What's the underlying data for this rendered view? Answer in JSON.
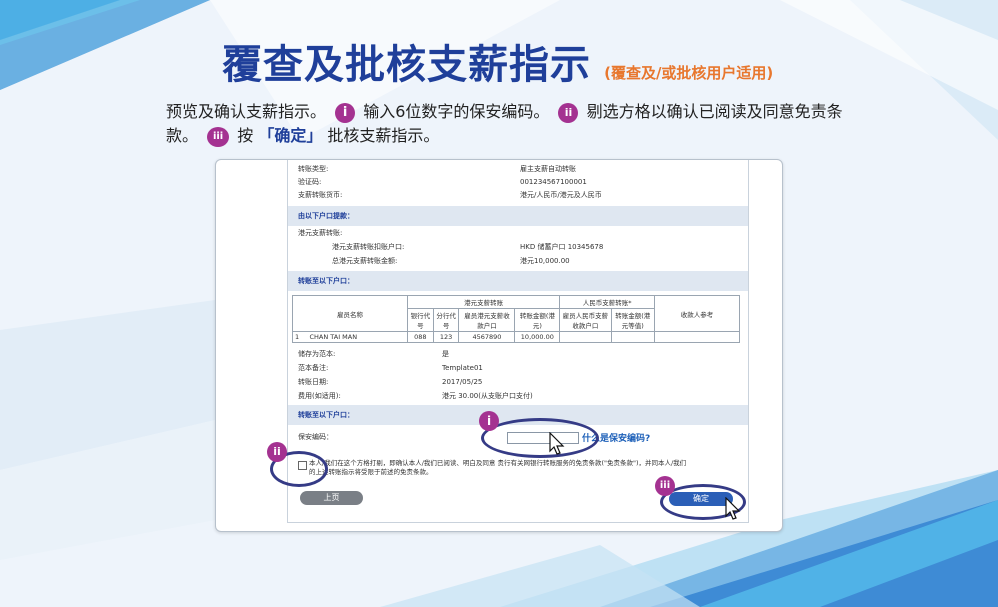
{
  "title": {
    "main": "覆查及批核支薪指示",
    "sub": "(覆查及/或批核用户适用)"
  },
  "instructions": {
    "part1": "预览及确认支薪指示。",
    "badge1": "i",
    "part2": "输入6位数字的保安编码。",
    "badge2": "ii",
    "part3": "剔选方格以确认已阅读及同意免责条款。",
    "badge3": "iii",
    "part4": "按",
    "confirm_label": "「确定」",
    "part5": "批核支薪指示。"
  },
  "colors": {
    "title": "#1f3f9a",
    "subtitle": "#e8772e",
    "badge": "#a43291",
    "ring": "#353b86",
    "section_bg": "#dfe7f1",
    "confirm_button": "#2b5fb7"
  },
  "form": {
    "summary": [
      {
        "label": "转账类型:",
        "value": "雇主支薪自动转账"
      },
      {
        "label": "验证码:",
        "value": "001234567100001"
      },
      {
        "label": "支薪转账货币:",
        "value": "港元/人民币/港元及人民币"
      }
    ],
    "section_from": "由以下户口提款：",
    "hkd_payroll": "港元支薪转账:",
    "debit_account_label": "港元支薪转账扣账户口:",
    "debit_account_value": "HKD 储蓄户口 10345678",
    "total_label": "总港元支薪转账金额:",
    "total_value": "港元10,000.00",
    "section_to": "转账至以下户口：",
    "table": {
      "group_hkd": "港元支薪转账",
      "group_rmb": "人民币支薪转账*",
      "col_name": "雇员名称",
      "col_bank": "银行代号",
      "col_branch": "分行代号",
      "col_acct": "雇员港元支薪收款户口",
      "col_amount": "转账金额(港元)",
      "col_rmb_acct": "雇员人民币支薪收款户口",
      "col_rmb_amount": "转账金额(港元等值)",
      "col_ref": "收款人参考",
      "row": {
        "no": "1",
        "name": "CHAN TAI MAN",
        "bank": "088",
        "branch": "123",
        "acct": "4567890",
        "amount": "10,000.00"
      }
    },
    "details": [
      {
        "label": "储存为范本:",
        "value": "是"
      },
      {
        "label": "范本备注:",
        "value": "Template01"
      },
      {
        "label": "转账日期:",
        "value": "2017/05/25"
      },
      {
        "label": "费用(如适用):",
        "value": "港元 30.00(从支账户口支付)"
      }
    ],
    "section_to2": "转账至以下户口：",
    "security_label": "保安编码：",
    "security_value": "",
    "help_link": "什么是保安编码?",
    "terms_line1": "本人/我们在这个方格打剔，即确认本人/我们已阅读、明白及同意 贵行有关网银行转账服务的免责条款(\"免责条款\")，并同本人/我们",
    "terms_line2": "的上述转账指示将受限于前述的免责条款。",
    "back_button": "上页",
    "confirm_button": "确定"
  },
  "markers": {
    "i": "i",
    "ii": "ii",
    "iii": "iii"
  }
}
